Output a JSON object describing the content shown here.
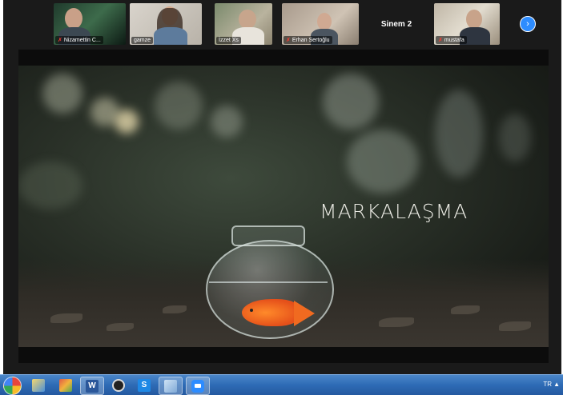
{
  "participants": [
    {
      "name": "Nizamettin C...",
      "muted": true
    },
    {
      "name": "gamze",
      "muted": false
    },
    {
      "name": "İzzet Xs",
      "muted": false
    },
    {
      "name": "Erhan Sertoğlu",
      "muted": true
    },
    {
      "name": "Sinem 2",
      "muted": false,
      "video_off": true
    },
    {
      "name": "mustafa",
      "muted": true
    }
  ],
  "gallery": {
    "next_icon": "chevron-right-icon",
    "next_glyph": "›"
  },
  "slide": {
    "title": "MARKALAŞMA"
  },
  "taskbar": {
    "apps": [
      "chrome-icon",
      "paint-icon",
      "photos-icon",
      "word-icon",
      "obs-icon",
      "app-s-icon",
      "network-app-icon",
      "zoom-icon"
    ],
    "word_glyph": "W",
    "s_glyph": "S",
    "language": "TR",
    "tray_glyph": "▲"
  },
  "colors": {
    "zoom_blue": "#2d8cff",
    "muted_red": "#ff3b30",
    "taskbar_blue": "#2e6bb5"
  }
}
